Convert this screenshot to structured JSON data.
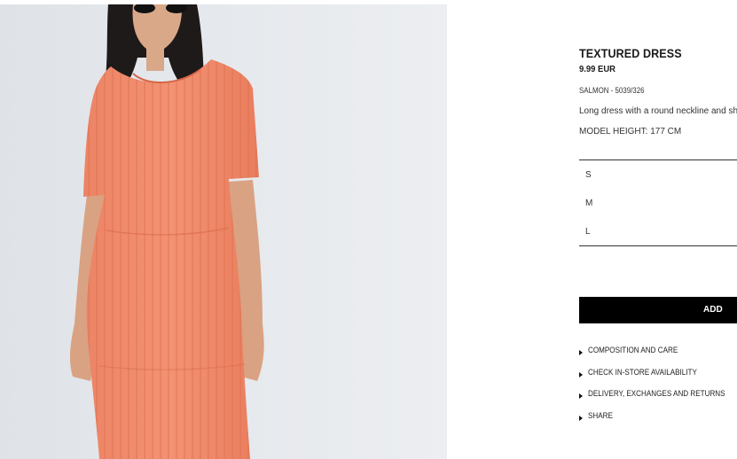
{
  "product": {
    "title": "TEXTURED DRESS",
    "price": "9.99 EUR",
    "color_ref": "SALMON - 5039/326",
    "description": "Long dress with a round neckline and sh",
    "model_height": "MODEL HEIGHT: 177 CM",
    "image_color": "#f08b6b"
  },
  "sizes": [
    "S",
    "M",
    "L"
  ],
  "actions": {
    "add_label": "ADD"
  },
  "links": [
    "COMPOSITION AND CARE",
    "CHECK IN-STORE AVAILABILITY",
    "DELIVERY, EXCHANGES AND RETURNS",
    "SHARE"
  ]
}
